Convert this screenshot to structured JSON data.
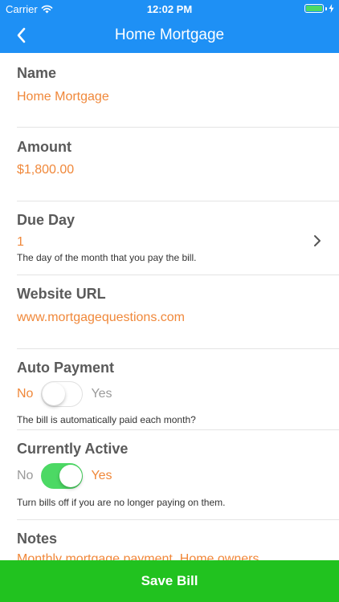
{
  "status_bar": {
    "carrier": "Carrier",
    "time": "12:02 PM",
    "battery_color": "#4cd964"
  },
  "nav": {
    "title": "Home Mortgage",
    "back_icon": "chevron-left-icon",
    "background": "#1e90f5"
  },
  "form": {
    "name": {
      "label": "Name",
      "value": "Home Mortgage"
    },
    "amount": {
      "label": "Amount",
      "value": "$1,800.00"
    },
    "due_day": {
      "label": "Due Day",
      "value": "1",
      "hint": "The day of the month that you pay the bill.",
      "chevron_icon": "chevron-right-icon"
    },
    "website": {
      "label": "Website URL",
      "value": "www.mortgagequestions.com"
    },
    "auto_payment": {
      "label": "Auto Payment",
      "off_label": "No",
      "on_label": "Yes",
      "is_on": false,
      "hint": "The bill is automatically paid each month?"
    },
    "currently_active": {
      "label": "Currently Active",
      "off_label": "No",
      "on_label": "Yes",
      "is_on": true,
      "hint": "Turn bills off if you are no longer paying on them."
    },
    "notes": {
      "label": "Notes",
      "value": "Monthly mortgage payment. Home owners"
    }
  },
  "actions": {
    "save_label": "Save Bill",
    "save_color": "#21c21f"
  },
  "colors": {
    "accent_value": "#f0883a",
    "label": "#5a5a5a",
    "toggle_on": "#4cd964"
  }
}
